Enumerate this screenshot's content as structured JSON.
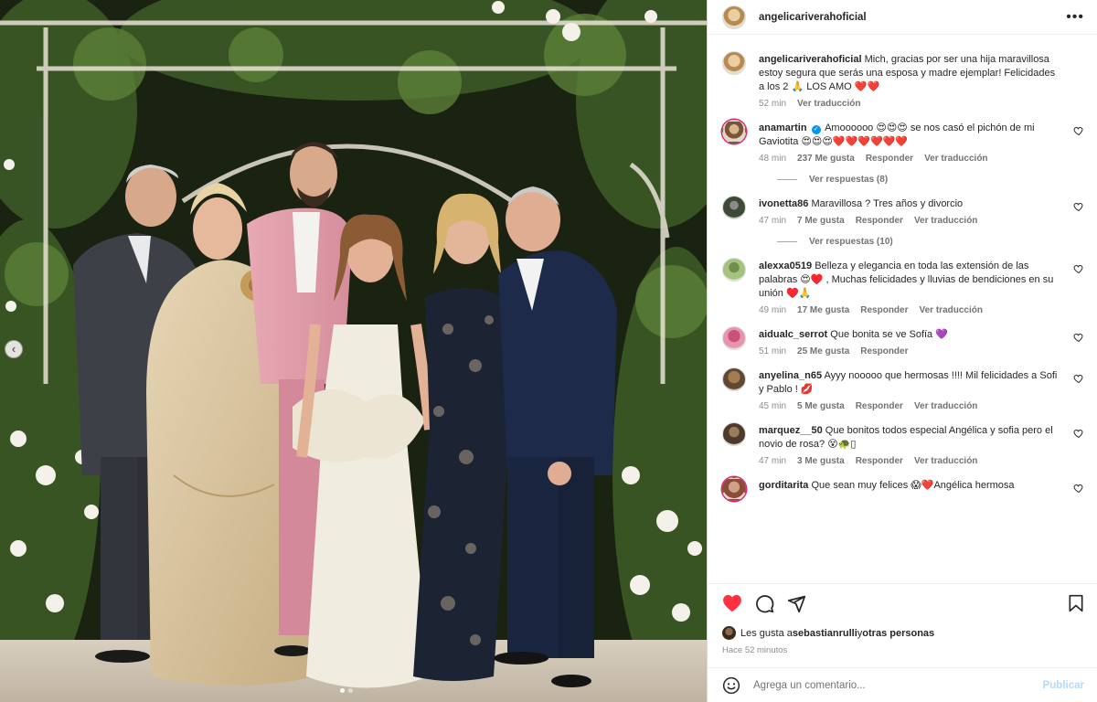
{
  "post": {
    "author": "angelicariverahoficial",
    "more_icon": "more-horizontal-icon",
    "carousel": {
      "dot_count": 2,
      "active_index": 0
    }
  },
  "caption": {
    "user": "angelicariverahoficial",
    "text": "Mich, gracias por ser una hija maravillosa estoy segura que serás una esposa y madre ejemplar! Felicidades a los 2 🙏 LOS AMO ❤️❤️",
    "time": "52 min",
    "translate": "Ver traducción"
  },
  "comments": [
    {
      "user": "anamartin",
      "verified": true,
      "text": "Amoooooo 😍😍😍 se nos casó el pichón de mi Gaviotita 😍😍😍❤️❤️❤️❤️❤️❤️",
      "time": "48 min",
      "likes": "237 Me gusta",
      "reply": "Responder",
      "translate": "Ver traducción",
      "replies": "Ver respuestas (8)"
    },
    {
      "user": "ivonetta86",
      "verified": false,
      "text": "Maravillosa ? Tres años y divorcio",
      "time": "47 min",
      "likes": "7 Me gusta",
      "reply": "Responder",
      "translate": "Ver traducción",
      "replies": "Ver respuestas (10)"
    },
    {
      "user": "alexxa0519",
      "verified": false,
      "text": "Belleza y elegancia en toda las extensión de las palabras 😍♥️ , Muchas felicidades y lluvias de bendiciones en su unión ♥️🙏",
      "time": "49 min",
      "likes": "17 Me gusta",
      "reply": "Responder",
      "translate": "Ver traducción",
      "replies": ""
    },
    {
      "user": "aidualc_serrot",
      "verified": false,
      "text": "Que bonita se ve Sofía 💜",
      "time": "51 min",
      "likes": "25 Me gusta",
      "reply": "Responder",
      "translate": "",
      "replies": ""
    },
    {
      "user": "anyelina_n65",
      "verified": false,
      "text": "Ayyy nooooo que hermosas !!!! Mil felicidades a Sofi y Pablo ! 💋",
      "time": "45 min",
      "likes": "5 Me gusta",
      "reply": "Responder",
      "translate": "Ver traducción",
      "replies": ""
    },
    {
      "user": "marquez__50",
      "verified": false,
      "text": "Que bonitos todos especial Angélica y sofia pero el novio de rosa? 😵🐢▯",
      "time": "47 min",
      "likes": "3 Me gusta",
      "reply": "Responder",
      "translate": "Ver traducción",
      "replies": ""
    },
    {
      "user": "gorditarita",
      "verified": false,
      "text": "Que sean muy felices 😱❤️Angélica hermosa",
      "time": "",
      "likes": "",
      "reply": "",
      "translate": "",
      "replies": ""
    }
  ],
  "actions": {
    "like_icon": "heart-filled-icon",
    "comment_icon": "comment-icon",
    "share_icon": "share-icon",
    "save_icon": "bookmark-icon",
    "liked_color": "#ff3040"
  },
  "likes_line": {
    "prefix": "Les gusta a ",
    "user": "sebastianrulli",
    "middle": " y ",
    "others": "otras personas"
  },
  "posted_ago": "Hace 52 minutos",
  "comment_box": {
    "emoji_icon": "emoji-icon",
    "placeholder": "Agrega un comentario...",
    "post_label": "Publicar"
  }
}
